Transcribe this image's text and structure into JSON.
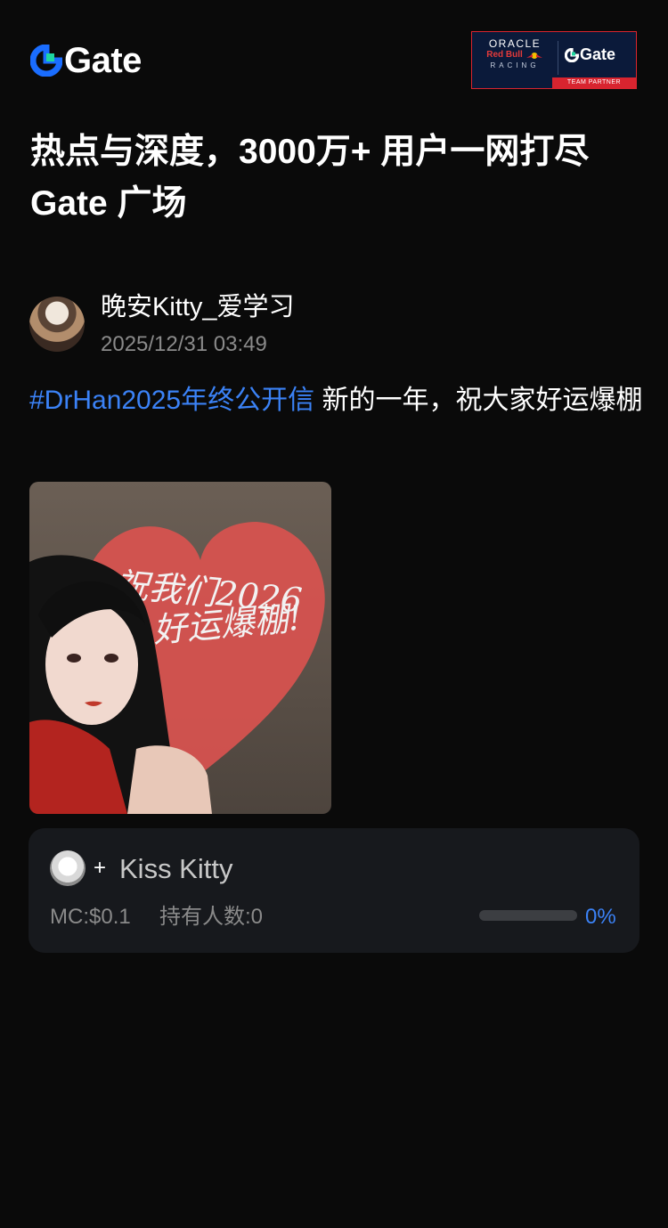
{
  "brand": {
    "name": "Gate",
    "accent": "#1a6dff"
  },
  "partner_badge": {
    "oracle": "ORACLE",
    "redbull": "Red Bull",
    "racing": "RACING",
    "gate": "Gate",
    "footer": "TEAM PARTNER"
  },
  "headline": "热点与深度，3000万+ 用户一网打尽 Gate 广场",
  "post": {
    "author": "晚安Kitty_爱学习",
    "timestamp": "2025/12/31 03:49",
    "hashtag": "#DrHan2025年终公开信",
    "text": " 新的一年，祝大家好运爆棚",
    "image_caption_line1": "祝我们2026",
    "image_caption_line2": "好运爆棚!"
  },
  "token": {
    "plus": "+",
    "name": "Kiss Kitty",
    "mc": "MC:$0.1",
    "holders": "持有人数:0",
    "progress_pct": "0%",
    "progress_fraction": 0
  },
  "colors": {
    "background": "#0a0a0a",
    "link": "#3b82f6",
    "card": "#17191d",
    "muted": "#8a8a8a"
  }
}
